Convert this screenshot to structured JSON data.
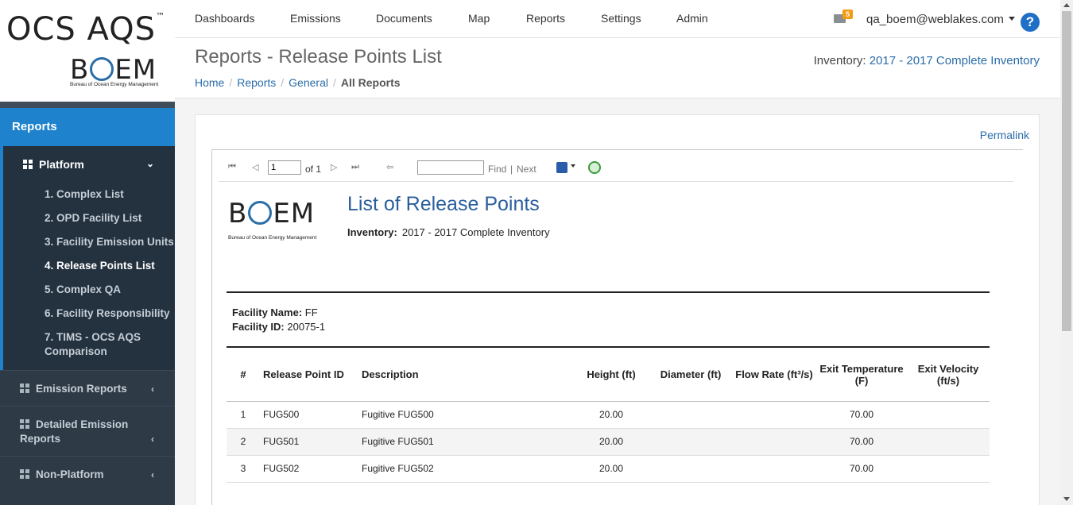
{
  "logo": {
    "ocs": "OCS AQS",
    "tm": "™",
    "boem_pre": "B",
    "boem_post": "EM",
    "boem_sub": "Bureau of Ocean Energy Management"
  },
  "sidebar": {
    "reports_label": "Reports",
    "platform_label": "Platform",
    "items": [
      {
        "label": "1. Complex List"
      },
      {
        "label": "2. OPD Facility List"
      },
      {
        "label": "3. Facility Emission Units"
      },
      {
        "label": "4. Release Points List"
      },
      {
        "label": "5. Complex QA"
      },
      {
        "label": "6. Facility Responsibility"
      },
      {
        "label": "7. TIMS - OCS AQS Comparison"
      }
    ],
    "groups": [
      {
        "label": "Emission Reports"
      },
      {
        "label": "Detailed Emission Reports"
      },
      {
        "label": "Non-Platform"
      }
    ]
  },
  "nav": {
    "items": [
      "Dashboards",
      "Emissions",
      "Documents",
      "Map",
      "Reports",
      "Settings",
      "Admin"
    ],
    "mail_count": "5",
    "user_email": "qa_boem@weblakes.com",
    "help": "?"
  },
  "header": {
    "title": "Reports - Release Points List",
    "inventory_label": "Inventory:",
    "inventory_value": "2017 - 2017 Complete Inventory",
    "breadcrumb": [
      "Home",
      "Reports",
      "General",
      "All Reports"
    ],
    "sep": "/"
  },
  "panel": {
    "permalink": "Permalink"
  },
  "toolbar": {
    "first_icon": "⏮",
    "prev_icon": "◁",
    "next_icon": "▷",
    "last_icon": "⏭",
    "back_icon": "⇦",
    "page_value": "1",
    "of_label": "of 1",
    "find_value": "",
    "find_label": "Find",
    "pipe": "|",
    "next_label": "Next"
  },
  "report": {
    "title": "List of Release Points",
    "inventory_label": "Inventory:",
    "inventory_value": "2017 - 2017 Complete Inventory",
    "facility_name_label": "Facility Name:",
    "facility_name": "FF",
    "facility_id_label": "Facility ID:",
    "facility_id": "20075-1",
    "columns": [
      "#",
      "Release Point ID",
      "Description",
      "Height (ft)",
      "Diameter (ft)",
      "Flow Rate (ft³/s)",
      "Exit Temperature (F)",
      "Exit Velocity (ft/s)"
    ],
    "rows": [
      {
        "n": "1",
        "id": "FUG500",
        "desc": "Fugitive FUG500",
        "height": "20.00",
        "diameter": "",
        "flow": "",
        "temp": "70.00",
        "vel": ""
      },
      {
        "n": "2",
        "id": "FUG501",
        "desc": "Fugitive FUG501",
        "height": "20.00",
        "diameter": "",
        "flow": "",
        "temp": "70.00",
        "vel": ""
      },
      {
        "n": "3",
        "id": "FUG502",
        "desc": "Fugitive FUG502",
        "height": "20.00",
        "diameter": "",
        "flow": "",
        "temp": "70.00",
        "vel": ""
      }
    ]
  }
}
